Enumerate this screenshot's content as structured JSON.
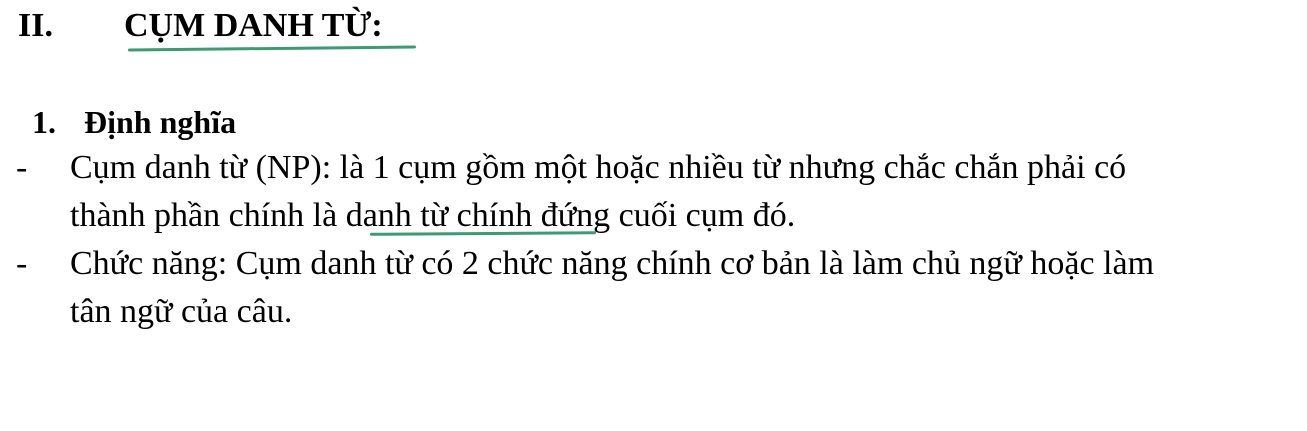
{
  "section": {
    "numeral": "II.",
    "title": "CỤM DANH TỪ:"
  },
  "subsection": {
    "number": "1.",
    "title": "Định nghĩa"
  },
  "bullets": [
    {
      "dash": "-",
      "line1_prefix": "Cụm danh từ (NP): là 1 cụm gồm một hoặc nhiều từ nhưng chắc chắn phải có",
      "line2_before": "thành phần chính là ",
      "line2_term": "danh từ chính",
      "line2_after": " đứng cuối cụm đó."
    },
    {
      "dash": "-",
      "line1": "Chức năng: Cụm danh từ có 2 chức năng chính cơ bản là làm chủ ngữ hoặc làm",
      "line2": "tân ngữ của câu."
    }
  ],
  "colors": {
    "text": "#000000",
    "annotation_underline": "#3e9a72",
    "background": "#ffffff"
  }
}
